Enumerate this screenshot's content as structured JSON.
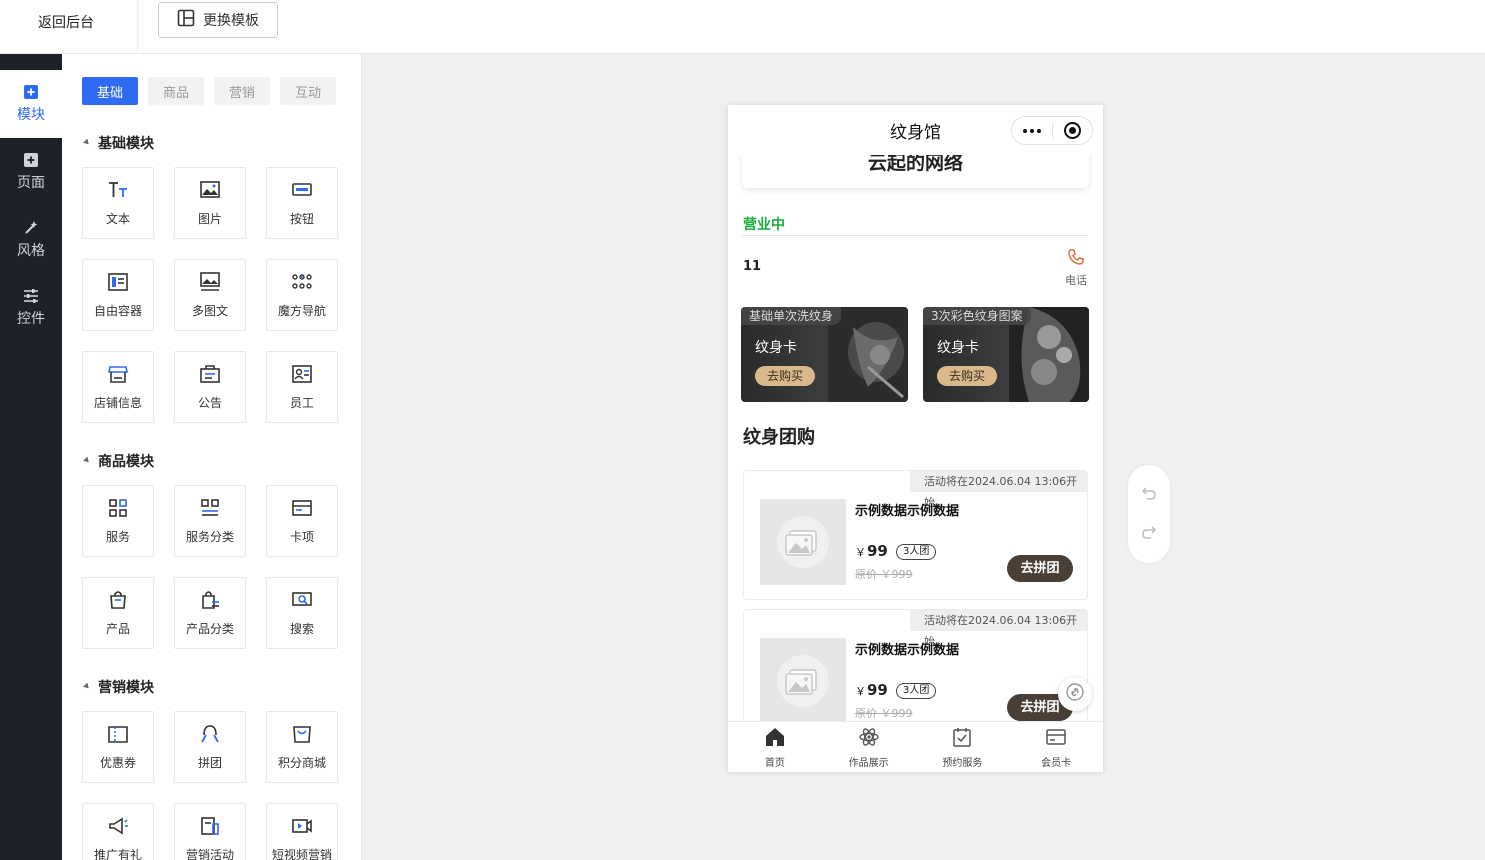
{
  "topbar": {
    "back_label": "返回后台",
    "template_button_label": "更换模板"
  },
  "sidebar": {
    "items": [
      {
        "label": "模块",
        "icon": "plus-square-icon",
        "active": true
      },
      {
        "label": "页面",
        "icon": "page-plus-icon",
        "active": false
      },
      {
        "label": "风格",
        "icon": "magic-wand-icon",
        "active": false
      },
      {
        "label": "控件",
        "icon": "sliders-icon",
        "active": false
      }
    ]
  },
  "panel": {
    "tabs": [
      "基础",
      "商品",
      "营销",
      "互动"
    ],
    "active_tab": "基础",
    "sections": [
      {
        "title": "基础模块",
        "modules": [
          "文本",
          "图片",
          "按钮",
          "自由容器",
          "多图文",
          "魔方导航",
          "店铺信息",
          "公告",
          "员工"
        ]
      },
      {
        "title": "商品模块",
        "modules": [
          "服务",
          "服务分类",
          "卡项",
          "产品",
          "产品分类",
          "搜索"
        ]
      },
      {
        "title": "营销模块",
        "modules": [
          "优惠券",
          "拼团",
          "积分商城",
          "推广有礼",
          "营销活动",
          "短视频营销"
        ]
      }
    ]
  },
  "phone": {
    "title": "纹身馆",
    "top_card_text": "云起的网络",
    "status": "营业中",
    "number": "11",
    "call_label": "电话",
    "promos": [
      {
        "tag": "基础单次洗纹身",
        "title": "纹身卡",
        "button": "去购买"
      },
      {
        "tag": "3次彩色纹身图案",
        "title": "纹身卡",
        "button": "去购买"
      }
    ],
    "group_title": "纹身团购",
    "deals": [
      {
        "notice": "活动将在2024.06.04 13:06开始",
        "name": "示例数据示例数据",
        "currency": "￥",
        "price": "99",
        "team": "3人团",
        "original": "原价 ￥999",
        "button": "去拼团"
      },
      {
        "notice": "活动将在2024.06.04 13:06开始",
        "name": "示例数据示例数据",
        "currency": "￥",
        "price": "99",
        "team": "3人团",
        "original": "原价 ￥999",
        "button": "去拼团"
      }
    ],
    "tabbar": [
      {
        "label": "首页",
        "icon": "home-icon"
      },
      {
        "label": "作品展示",
        "icon": "atom-icon"
      },
      {
        "label": "预约服务",
        "icon": "calendar-check-icon"
      },
      {
        "label": "会员卡",
        "icon": "card-icon"
      }
    ]
  },
  "colors": {
    "primary": "#2f6bf0",
    "sidebar_bg": "#1f2129",
    "open_green": "#19ad3a",
    "buy_gold": "#d9b98b",
    "group_button": "#4a3f36"
  }
}
